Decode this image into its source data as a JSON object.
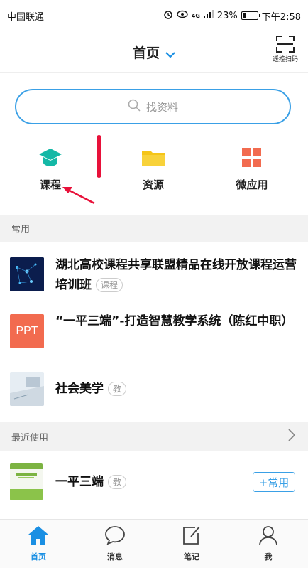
{
  "status_bar": {
    "carrier": "中国联通",
    "signal_label": "4G",
    "battery_percent": "23%",
    "battery_level": 0.23,
    "time": "下午2:58"
  },
  "header": {
    "title": "首页",
    "scan_label": "遥控扫码"
  },
  "search": {
    "placeholder": "找资料"
  },
  "entries": [
    {
      "label": "课程",
      "icon": "graduation-cap-icon"
    },
    {
      "label": "资源",
      "icon": "folder-icon"
    },
    {
      "label": "微应用",
      "icon": "apps-grid-icon"
    }
  ],
  "sections": {
    "common": "常用",
    "recent": "最近使用"
  },
  "common_items": [
    {
      "title": "湖北高校课程共享联盟精品在线开放课程运营培训班",
      "tag": "课程",
      "thumb": "blue-network"
    },
    {
      "title": "“一平三端”-打造智慧教学系统（陈红中职）",
      "tag": "",
      "thumb": "ppt"
    },
    {
      "title": "社会美学",
      "tag": "教",
      "thumb": "desk-photo"
    }
  ],
  "recent_items": [
    {
      "title": "一平三端",
      "tag": "教",
      "button": "+常用",
      "thumb": "green-book"
    }
  ],
  "ppt_label": "PPT",
  "tabs": [
    {
      "label": "首页",
      "icon": "home-icon",
      "active": true
    },
    {
      "label": "消息",
      "icon": "chat-bubble-icon",
      "active": false
    },
    {
      "label": "笔记",
      "icon": "note-edit-icon",
      "active": false
    },
    {
      "label": "我",
      "icon": "user-icon",
      "active": false
    }
  ],
  "colors": {
    "accent": "#1a8fe3",
    "search_border": "#3aa0e6",
    "course_icon": "#14b8a6",
    "folder_icon": "#f5c518",
    "apps_icon": "#f26b4f",
    "ppt_bg": "#f26b4f",
    "annotation": "#e8113a"
  }
}
